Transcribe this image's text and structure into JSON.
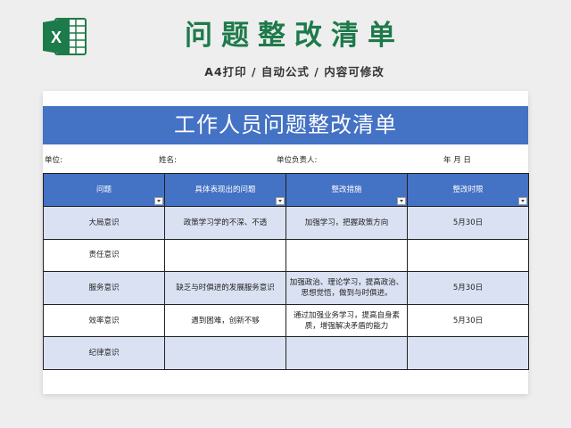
{
  "header": {
    "title": "问题整改清单",
    "subtitle": "A4打印 / 自动公式 / 内容可修改",
    "logo_icon": "excel-icon",
    "logo_letter": "X"
  },
  "sheet": {
    "title": "工作人员问题整改清单",
    "info": {
      "unit_label": "单位:",
      "name_label": "姓名:",
      "leader_label": "单位负责人:",
      "date_label": "年    月    日"
    },
    "columns": [
      "问题",
      "具体表现出的问题",
      "整改措施",
      "整改时限"
    ],
    "rows": [
      [
        "大局意识",
        "政策学习学的不深、不透",
        "加强学习，把握政策方向",
        "5月30日"
      ],
      [
        "责任意识",
        "",
        "",
        ""
      ],
      [
        "服务意识",
        "缺乏与时俱进的发展服务意识",
        "加强政治、理论学习，提高政治、思想觉悟，做到与时俱进。",
        "5月30日"
      ],
      [
        "效率意识",
        "遇到困难，创新不够",
        "通过加强业务学习，提高自身素质，增强解决矛盾的能力",
        "5月30日"
      ],
      [
        "纪律意识",
        "",
        "",
        ""
      ]
    ]
  },
  "colors": {
    "brand_green": "#1d7a4a",
    "header_blue": "#4472c4",
    "row_shade": "#dae1f2"
  }
}
